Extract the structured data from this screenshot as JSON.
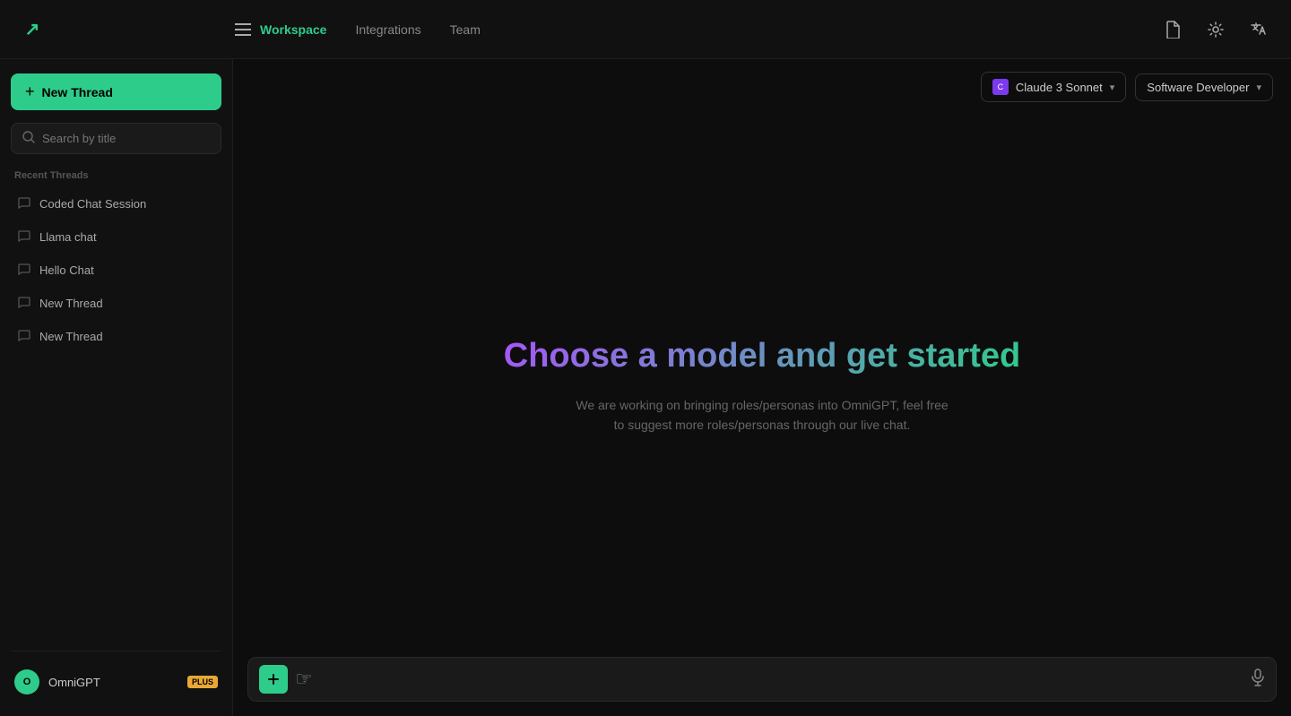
{
  "app": {
    "logo": "↗",
    "title": "OmniGPT"
  },
  "topnav": {
    "tabs": [
      {
        "id": "workspace",
        "label": "Workspace",
        "active": true
      },
      {
        "id": "integrations",
        "label": "Integrations",
        "active": false
      },
      {
        "id": "team",
        "label": "Team",
        "active": false
      }
    ],
    "icons": {
      "document": "📄",
      "settings": "⚙",
      "translate": "Aa"
    }
  },
  "sidebar": {
    "new_thread_label": "+ New Thread",
    "search_placeholder": "Search by title",
    "recent_threads_label": "Recent Threads",
    "threads": [
      {
        "id": 1,
        "label": "Coded Chat Session"
      },
      {
        "id": 2,
        "label": "Llama chat"
      },
      {
        "id": 3,
        "label": "Hello Chat"
      },
      {
        "id": 4,
        "label": "New Thread"
      },
      {
        "id": 5,
        "label": "New Thread"
      }
    ],
    "user": {
      "name": "OmniGPT",
      "plan": "PLUS",
      "initial": "O"
    }
  },
  "toolbar": {
    "model_label": "Claude 3 Sonnet",
    "model_icon": "C",
    "chevron_label": "▾",
    "role_label": "Software Developer",
    "role_chevron": "▾"
  },
  "main": {
    "headline": "Choose a model and get started",
    "subtext": "We are working on bringing roles/personas into OmniGPT, feel free to suggest more roles/personas through our live chat."
  },
  "chat_input": {
    "placeholder": "",
    "mic_icon": "🎤"
  }
}
